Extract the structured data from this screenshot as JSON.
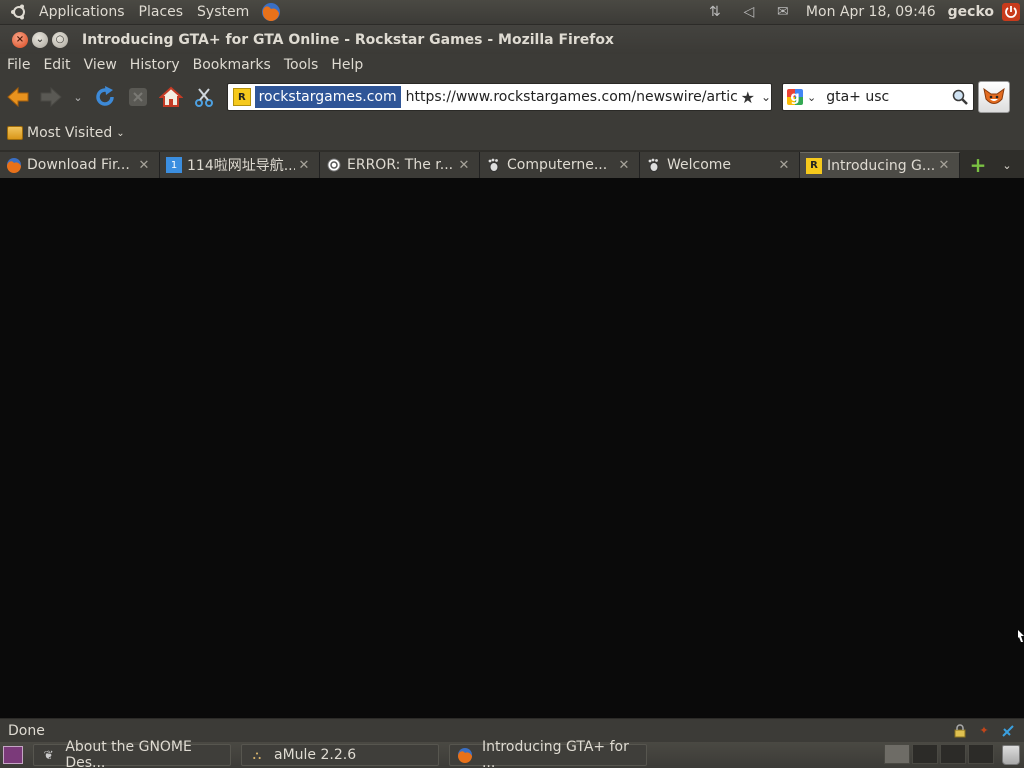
{
  "top_panel": {
    "menus": [
      "Applications",
      "Places",
      "System"
    ],
    "clock": "Mon Apr 18, 09:46",
    "user": "gecko"
  },
  "window": {
    "title": "Introducing GTA+ for GTA Online - Rockstar Games - Mozilla Firefox"
  },
  "menubar": {
    "items": [
      {
        "label": "File"
      },
      {
        "label": "Edit"
      },
      {
        "label": "View"
      },
      {
        "label": "History"
      },
      {
        "label": "Bookmarks"
      },
      {
        "label": "Tools"
      },
      {
        "label": "Help"
      }
    ]
  },
  "navbar": {
    "domain": "rockstargames.com",
    "url": "https://www.rockstargames.com/newswire/article/ak",
    "search_value": "gta+ usc"
  },
  "bookmarks": {
    "most_visited": "Most Visited"
  },
  "tabs": [
    {
      "label": "Download Fir...",
      "icon": "firefox-icon"
    },
    {
      "label": "114啦网址导航...",
      "icon": "site-114-icon"
    },
    {
      "label": "ERROR: The r...",
      "icon": "error-page-icon"
    },
    {
      "label": "Computerne...",
      "icon": "gnome-foot-icon"
    },
    {
      "label": "Welcome",
      "icon": "gnome-foot-icon"
    },
    {
      "label": "Introducing G...",
      "icon": "rockstar-icon",
      "active": true
    }
  ],
  "status": {
    "text": "Done"
  },
  "taskbar": {
    "items": [
      {
        "label": "About the GNOME Des..."
      },
      {
        "label": "aMule 2.2.6"
      },
      {
        "label": "Introducing GTA+ for ..."
      }
    ]
  },
  "colors": {
    "panel": "#3c3b37",
    "content_bg": "#0a0a0a",
    "url_highlight": "#2f5597",
    "close_button": "#d8461c"
  }
}
